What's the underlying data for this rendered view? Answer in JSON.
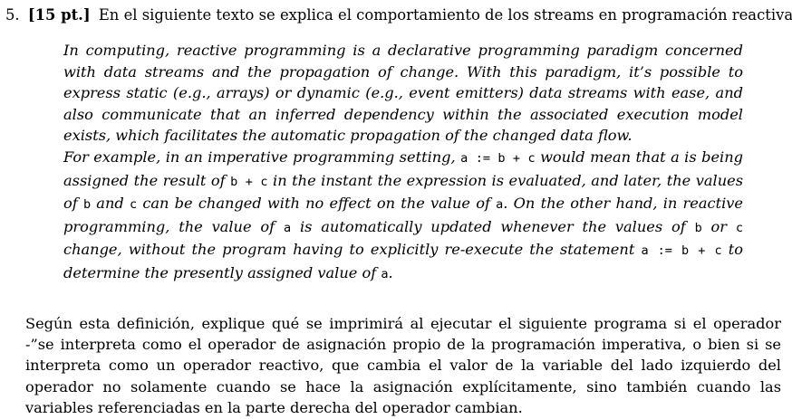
{
  "question": {
    "number": "5.",
    "points": "[15 pt.]",
    "intro": "En el siguiente texto se explica el comportamiento de los streams en programación reactiva."
  },
  "quote": {
    "p1": "In computing, reactive programming is a declarative programming paradigm concerned with data streams and the propagation of change. With this paradigm, it’s possible to express static (e.g., arrays) or dynamic (e.g., event emitters) data streams with ease, and also communicate that an inferred dependency within the associated execution model exists, which facilitates the automatic propagation of the changed data flow.",
    "p2": [
      {
        "t": "For example, in an imperative programming setting, "
      },
      {
        "c": "a := b + c"
      },
      {
        "t": " would mean that a is being assigned the result of "
      },
      {
        "c": "b + c"
      },
      {
        "t": " in the instant the expression is evaluated, and later, the values of "
      },
      {
        "c": "b"
      },
      {
        "t": " and "
      },
      {
        "c": "c"
      },
      {
        "t": " can be changed with no effect on the value of "
      },
      {
        "c": "a"
      },
      {
        "t": ". On the other hand, in reactive programming, the value of "
      },
      {
        "c": "a"
      },
      {
        "t": " is automatically updated whenever the values of "
      },
      {
        "c": "b"
      },
      {
        "t": " or "
      },
      {
        "c": "c"
      },
      {
        "t": " change, without the program having to explicitly re-execute the statement "
      },
      {
        "c": "a := b + c"
      },
      {
        "t": " to determine the presently assigned value of "
      },
      {
        "c": "a"
      },
      {
        "t": "."
      }
    ]
  },
  "body": "Según esta definición, explique qué se imprimirá al ejecutar el siguiente programa si el operador -”se interpreta como el operador de asignación propio de la programación imperativa, o bien si se interpreta como un operador reactivo, que cambia el valor de la variable del lado izquierdo del operador no solamente cuando se hace la asignación explícitamente, sino también cuando las variables referenciadas en la parte derecha del operador cambian."
}
